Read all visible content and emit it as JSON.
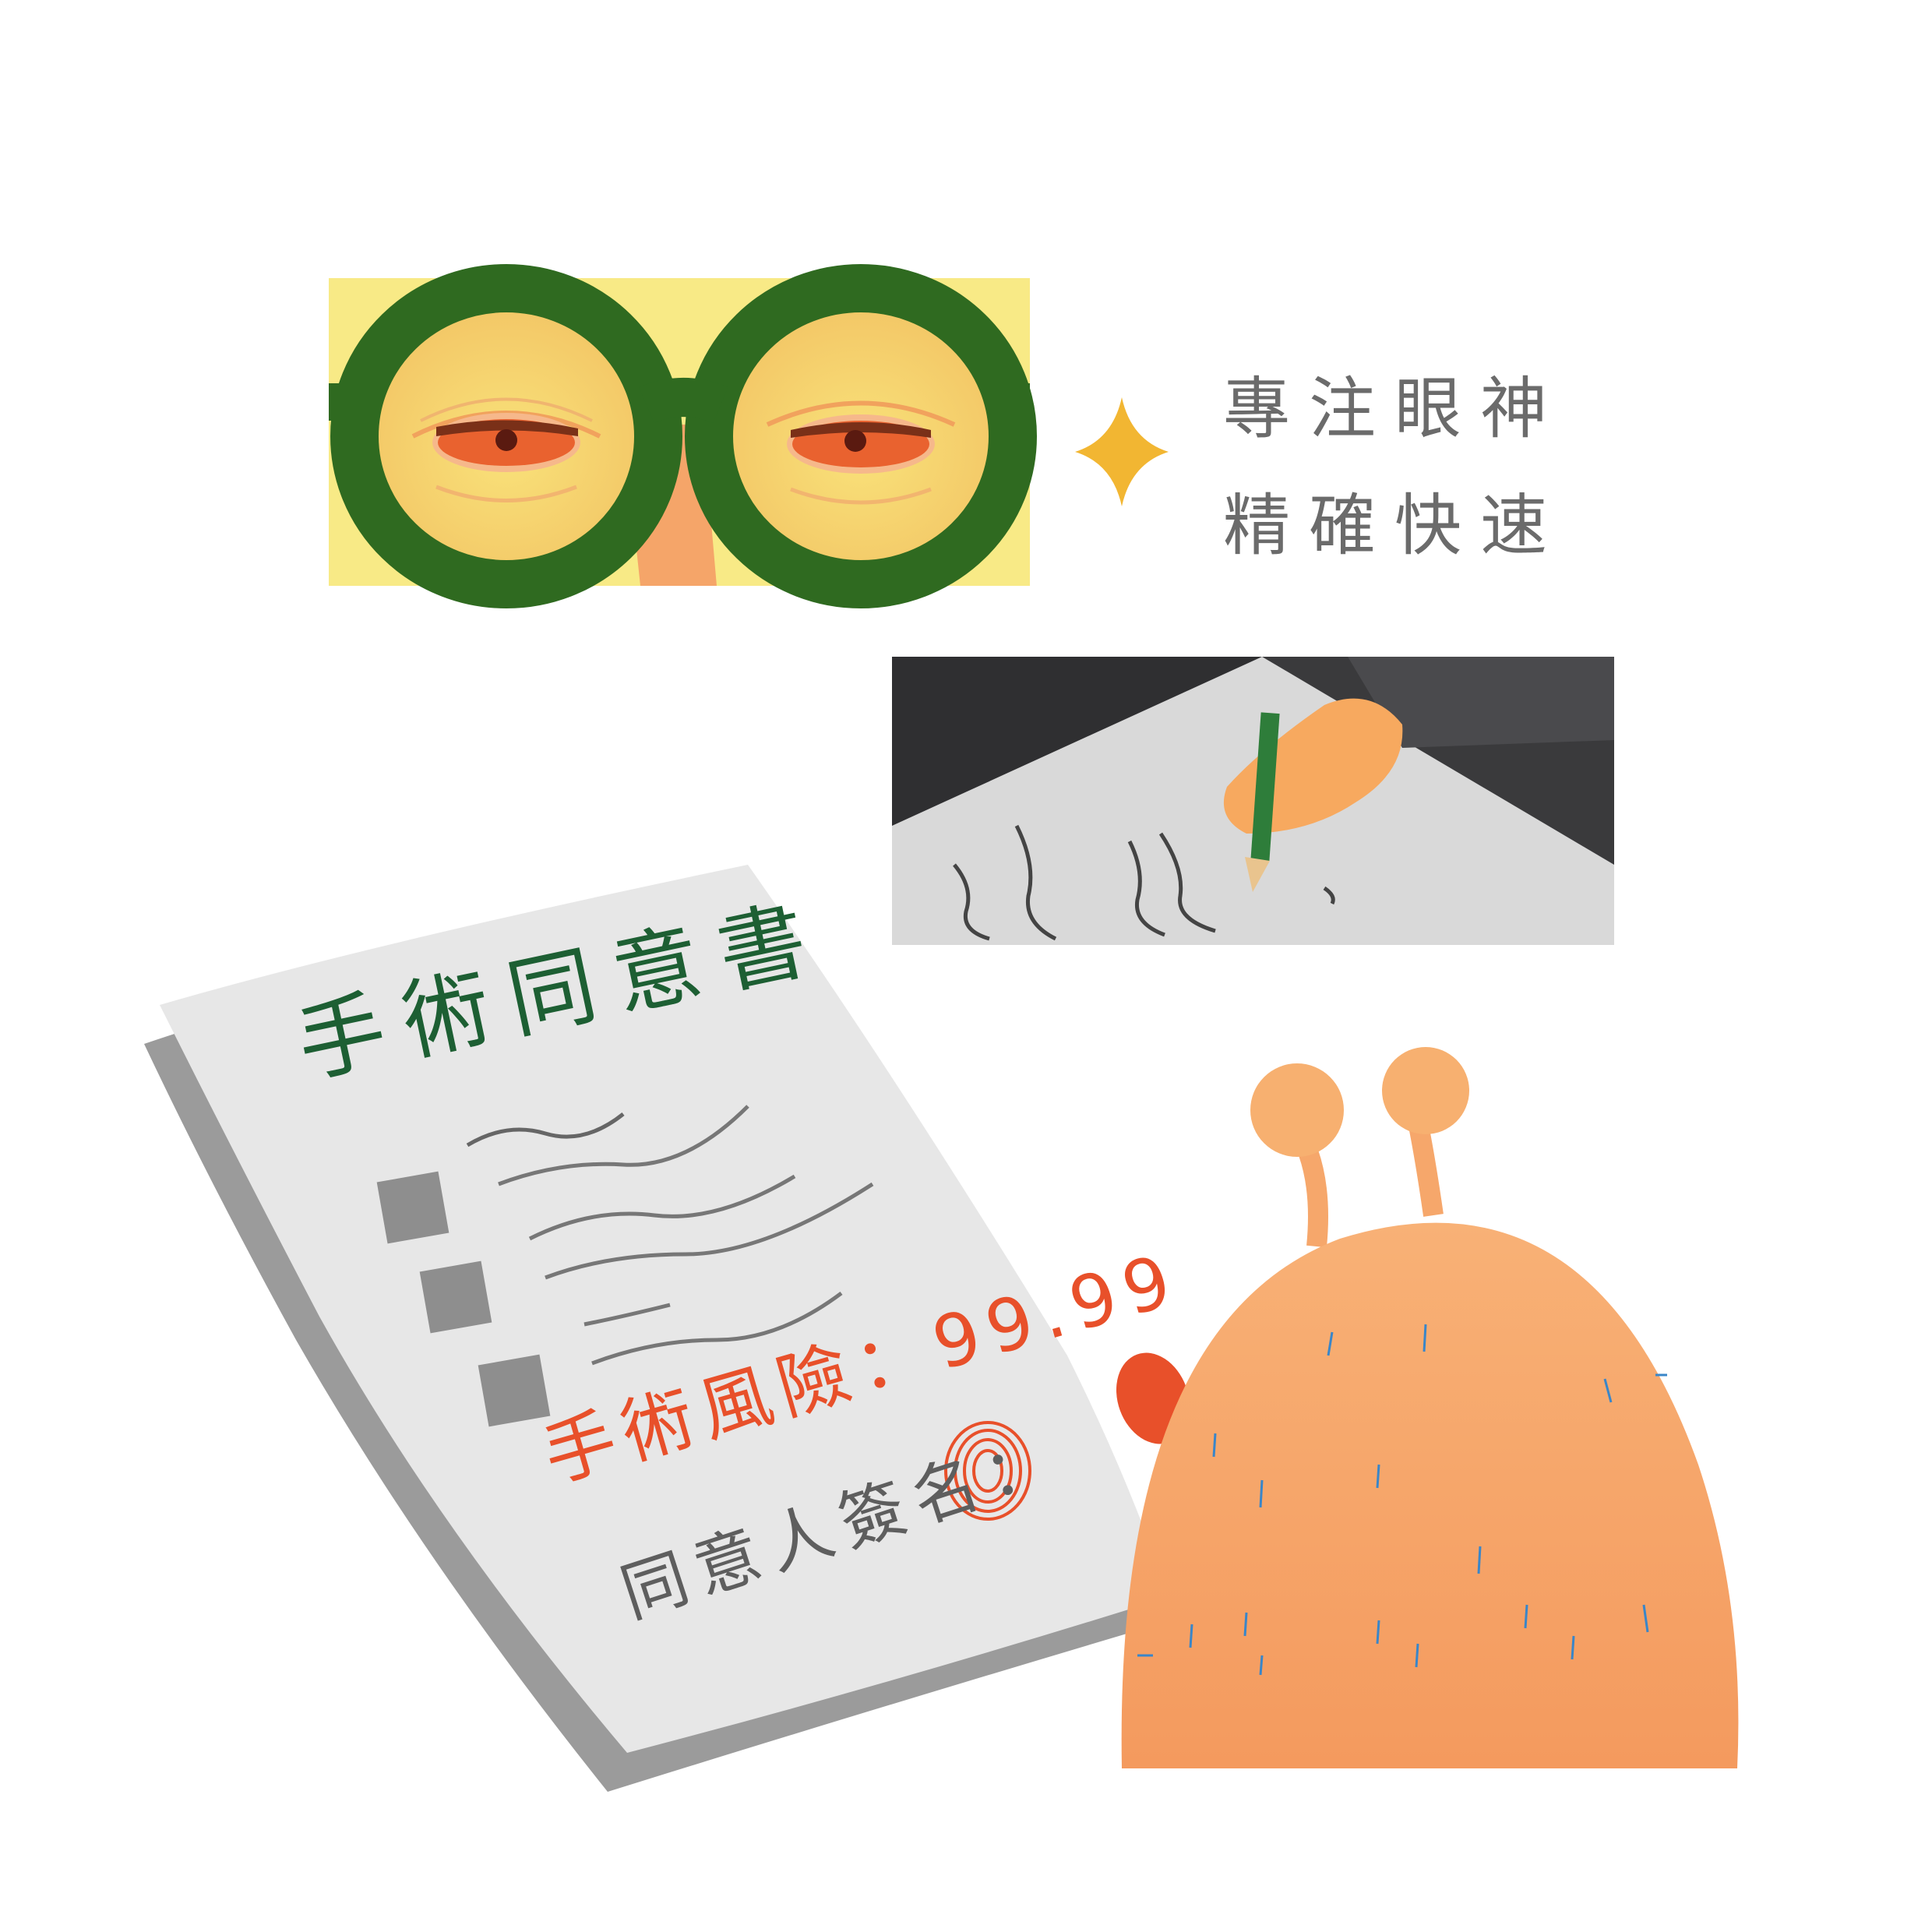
{
  "caption": {
    "line1": "專注眼神",
    "line2": "精確快速"
  },
  "consent_form": {
    "title": "手術同意書",
    "risk_line": "手術風險：99.99",
    "signature_label": "同意人簽名："
  },
  "colors": {
    "glasses_frame": "#2f6a20",
    "glasses_background": "#f8ea86",
    "skin": "#f6a766",
    "sparkle": "#f2b632",
    "form_title": "#1d5f33",
    "form_risk": "#e8502a",
    "creature": "#f6a76b"
  },
  "icons": {
    "sparkle": "sparkle-icon",
    "fingerprint": "fingerprint-icon"
  }
}
